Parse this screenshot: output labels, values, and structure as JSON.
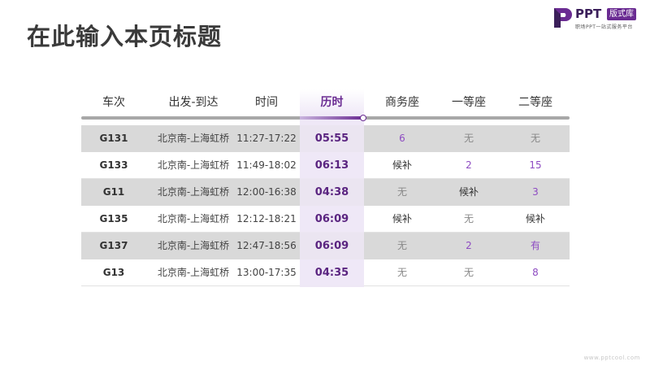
{
  "title": "在此输入本页标题",
  "logo": {
    "text": "PPT",
    "badge": "版式库",
    "subtitle": "职场PPT一站式服务平台"
  },
  "footer_url": "www.pptcool.com",
  "accent_color": "#6a2b92",
  "table": {
    "headers": [
      "车次",
      "出发-到达",
      "时间",
      "历时",
      "商务座",
      "一等座",
      "二等座"
    ],
    "active_header_index": 3,
    "rows": [
      {
        "train": "G131",
        "route": "北京南-上海虹桥",
        "time": "11:27-17:22",
        "duration": "05:55",
        "business": "6",
        "first": "无",
        "second": "无"
      },
      {
        "train": "G133",
        "route": "北京南-上海虹桥",
        "time": "11:49-18:02",
        "duration": "06:13",
        "business": "候补",
        "first": "2",
        "second": "15"
      },
      {
        "train": "G11",
        "route": "北京南-上海虹桥",
        "time": "12:00-16:38",
        "duration": "04:38",
        "business": "无",
        "first": "候补",
        "second": "3"
      },
      {
        "train": "G135",
        "route": "北京南-上海虹桥",
        "time": "12:12-18:21",
        "duration": "06:09",
        "business": "候补",
        "first": "无",
        "second": "候补"
      },
      {
        "train": "G137",
        "route": "北京南-上海虹桥",
        "time": "12:47-18:56",
        "duration": "06:09",
        "business": "无",
        "first": "2",
        "second": "有"
      },
      {
        "train": "G13",
        "route": "北京南-上海虹桥",
        "time": "13:00-17:35",
        "duration": "04:35",
        "business": "无",
        "first": "无",
        "second": "8"
      }
    ]
  }
}
